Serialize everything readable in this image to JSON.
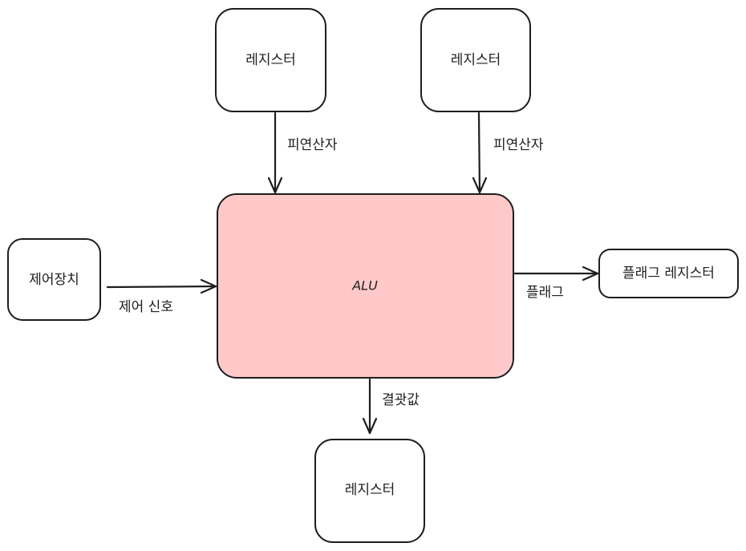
{
  "colors": {
    "stroke": "#1e1e1e",
    "alu_fill": "#ffc9c9",
    "box_fill": "#ffffff",
    "background": "#ffffff"
  },
  "nodes": {
    "register_left": "레지스터",
    "register_right": "레지스터",
    "alu": "ALU",
    "control_unit": "제어장치",
    "flag_register": "플래그 레지스터",
    "register_bottom": "레지스터"
  },
  "edges": {
    "operand_left": "피연산자",
    "operand_right": "피연산자",
    "control_signal": "제어 신호",
    "flag": "플래그",
    "result": "결괏값"
  }
}
